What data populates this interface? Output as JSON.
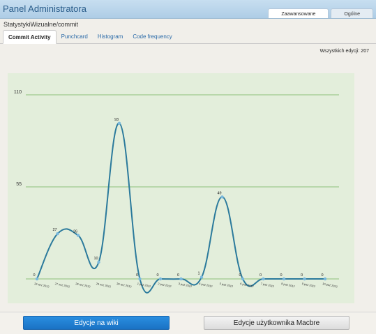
{
  "header": {
    "title": "Panel Administratora",
    "tabs": [
      {
        "label": "Zaawansowane",
        "active": true
      },
      {
        "label": "Ogólne",
        "active": false
      }
    ]
  },
  "breadcrumb": "StatystykiWizualne/commit",
  "tabs": [
    {
      "label": "Commit Activity",
      "active": true
    },
    {
      "label": "Punchcard",
      "active": false
    },
    {
      "label": "Histogram",
      "active": false
    },
    {
      "label": "Code frequency",
      "active": false
    }
  ],
  "total_edits": "Wszystkich edycji: 207",
  "chart_data": {
    "type": "line",
    "categories": [
      "26 wrz 2012",
      "27 wrz 2012",
      "28 wrz 2012",
      "29 wrz 2012",
      "30 wrz 2012",
      "1 paź 2012",
      "2 paź 2012",
      "3 paź 2012",
      "4 paź 2012",
      "5 paź 2012",
      "6 paź 2012",
      "7 paź 2012",
      "8 paź 2012",
      "9 paź 2012",
      "10 paź 2012"
    ],
    "values": [
      0,
      27,
      26,
      10,
      93,
      0,
      0,
      0,
      1,
      49,
      0,
      0,
      0,
      0,
      0
    ],
    "ylim": [
      0,
      110
    ],
    "yticks": [
      55,
      110
    ],
    "grid": true,
    "colors": {
      "line": "#2b7a9c",
      "point": "#79b8dd",
      "grid": "#8cc07a",
      "background": "#e3eedb"
    }
  },
  "footer": {
    "primary_label": "Edycje na wiki",
    "secondary_label": "Edycje użytkownika Macbre"
  }
}
